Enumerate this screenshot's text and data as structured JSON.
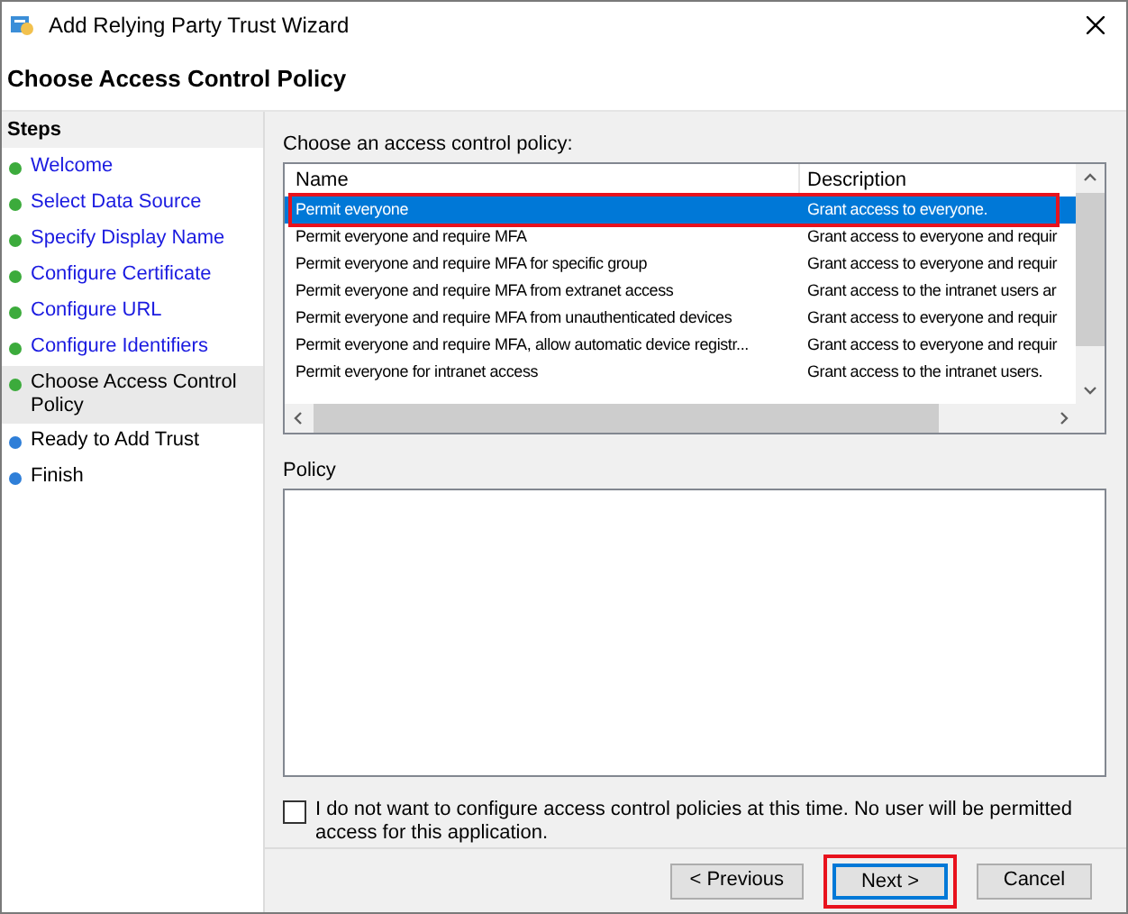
{
  "window": {
    "title": "Add Relying Party Trust Wizard"
  },
  "page_title": "Choose Access Control Policy",
  "steps": {
    "heading": "Steps",
    "items": [
      {
        "label": "Welcome",
        "color": "#3cab3c",
        "selected": false
      },
      {
        "label": "Select Data Source",
        "color": "#3cab3c",
        "selected": false
      },
      {
        "label": "Specify Display Name",
        "color": "#3cab3c",
        "selected": false
      },
      {
        "label": "Configure Certificate",
        "color": "#3cab3c",
        "selected": false
      },
      {
        "label": "Configure URL",
        "color": "#3cab3c",
        "selected": false
      },
      {
        "label": "Configure Identifiers",
        "color": "#3cab3c",
        "selected": false
      },
      {
        "label": "Choose Access Control Policy",
        "color": "#3cab3c",
        "selected": true
      },
      {
        "label": "Ready to Add Trust",
        "color": "#2f7fd8",
        "selected": false
      },
      {
        "label": "Finish",
        "color": "#2f7fd8",
        "selected": false
      }
    ]
  },
  "policy_list": {
    "label": "Choose an access control policy:",
    "columns": [
      "Name",
      "Description"
    ],
    "rows": [
      {
        "name": "Permit everyone",
        "description": "Grant access to everyone.",
        "selected": true,
        "highlighted": true
      },
      {
        "name": "Permit everyone and require MFA",
        "description": "Grant access to everyone and requir",
        "selected": false,
        "highlighted": false
      },
      {
        "name": "Permit everyone and require MFA for specific group",
        "description": "Grant access to everyone and requir",
        "selected": false,
        "highlighted": false
      },
      {
        "name": "Permit everyone and require MFA from extranet access",
        "description": "Grant access to the intranet users ar",
        "selected": false,
        "highlighted": false
      },
      {
        "name": "Permit everyone and require MFA from unauthenticated devices",
        "description": "Grant access to everyone and requir",
        "selected": false,
        "highlighted": false
      },
      {
        "name": "Permit everyone and require MFA, allow automatic device registr...",
        "description": "Grant access to everyone and requir",
        "selected": false,
        "highlighted": false
      },
      {
        "name": "Permit everyone for intranet access",
        "description": "Grant access to the intranet users.",
        "selected": false,
        "highlighted": false
      }
    ]
  },
  "policy": {
    "label": "Policy"
  },
  "skip_checkbox": {
    "label": "I do not want to configure access control policies at this time. No user will be permitted access for this application.",
    "checked": false
  },
  "buttons": [
    {
      "label": "< Previous",
      "highlighted": false,
      "default": false
    },
    {
      "label": "Next >",
      "highlighted": true,
      "default": true
    },
    {
      "label": "Cancel",
      "highlighted": false,
      "default": false
    }
  ]
}
